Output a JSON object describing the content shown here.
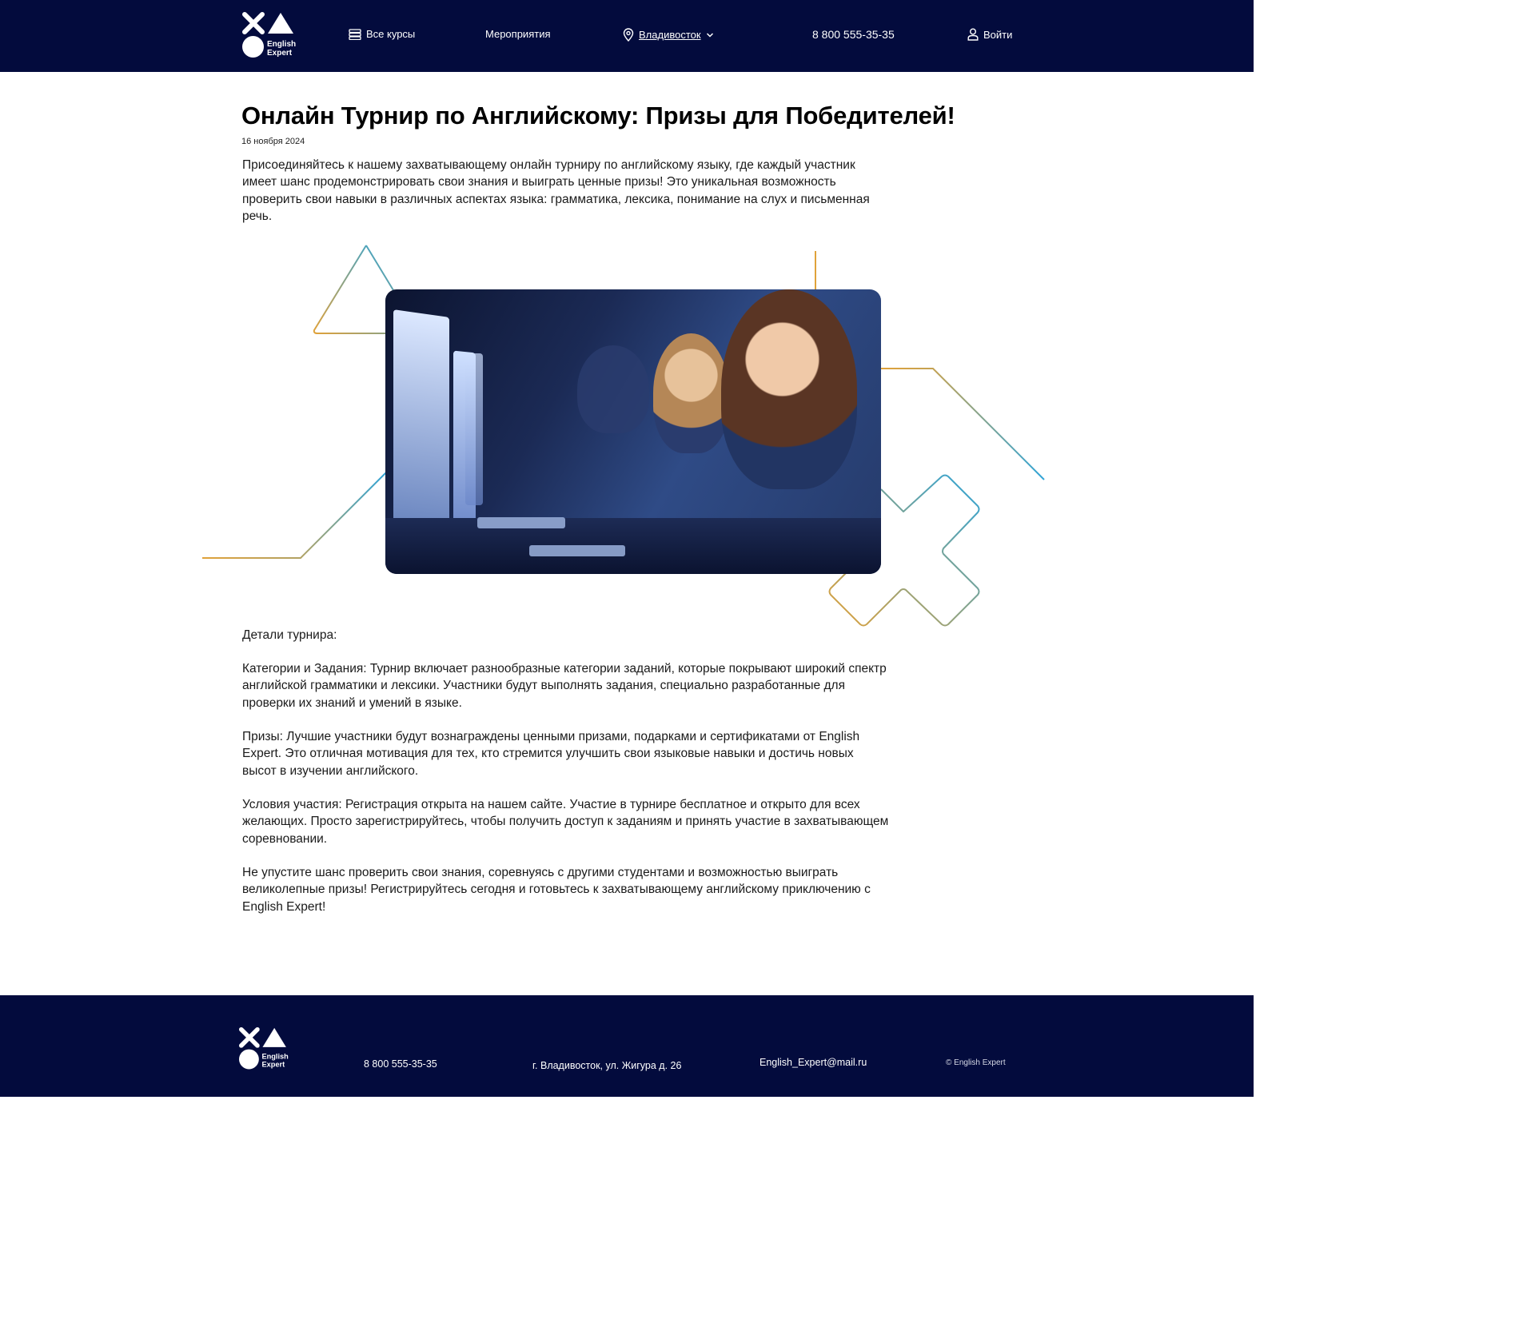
{
  "header": {
    "logo_text": "English\nExpert",
    "nav": {
      "courses_label": "Все курсы",
      "events_label": "Мероприятия",
      "city_label": "Владивосток",
      "phone": "8 800 555-35-35",
      "login_label": "Войти"
    },
    "icons": {
      "courses": "courses-icon",
      "location": "location-pin-icon",
      "dropdown": "chevron-down-icon",
      "user": "user-icon"
    }
  },
  "article": {
    "title": "Онлайн Турнир по Английскому: Призы для Победителей!",
    "date": "16 ноября 2024",
    "intro": "Присоединяйтесь к нашему захватывающему онлайн турниру по английскому языку, где каждый участник имеет шанс продемонстрировать свои знания и выиграть ценные призы! Это уникальная возможность проверить свои навыки в различных аспектах языка: грамматика, лексика, понимание на слух и письменная речь.",
    "details_heading": "Детали турнира:",
    "paragraphs": [
      "Категории и Задания: Турнир включает разнообразные категории заданий, которые покрывают широкий спектр английской грамматики и лексики. Участники будут выполнять задания, специально разработанные для проверки их знаний и умений в языке.",
      "Призы: Лучшие участники будут вознаграждены ценными призами, подарками и сертификатами от English Expert. Это отличная мотивация для тех, кто стремится улучшить свои языковые навыки и достичь новых высот в изучении английского.",
      "Условия участия: Регистрация открыта на нашем сайте. Участие в турнире бесплатное и открыто для всех желающих. Просто зарегистрируйтесь, чтобы получить доступ к заданиям и принять участие в захватывающем соревновании.",
      "Не упустите шанс проверить свои знания, соревнуясь с другими студентами и возможностью выиграть великолепные призы! Регистрируйтесь сегодня и готовьтесь к захватывающему английскому приключению с English Expert!"
    ]
  },
  "footer": {
    "logo_text": "English\nExpert",
    "phone": "8 800 555-35-35",
    "address": "г. Владивосток, ул. Жигура д. 26",
    "email": "English_Expert@mail.ru",
    "copyright": "© English Expert"
  },
  "colors": {
    "navy": "#030b3d",
    "deco_orange": "#e0a23a",
    "deco_blue": "#2fa4d8"
  }
}
